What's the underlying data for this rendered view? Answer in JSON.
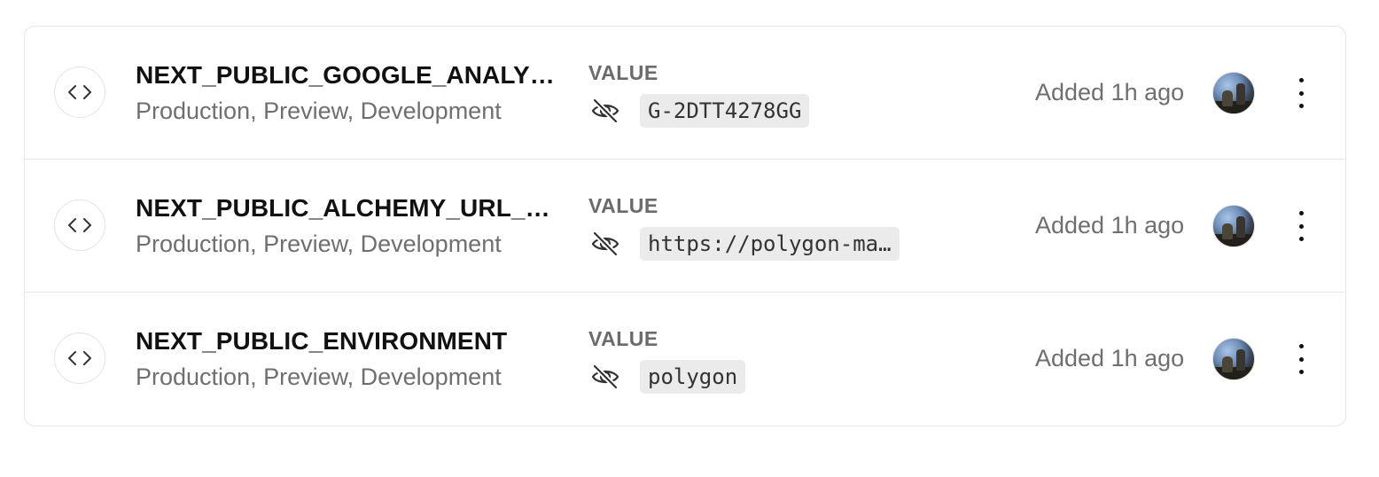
{
  "value_label": "VALUE",
  "rows": [
    {
      "name": "NEXT_PUBLIC_GOOGLE_ANALYTI…",
      "environments": "Production, Preview, Development",
      "value": "G-2DTT4278GG",
      "added": "Added 1h ago"
    },
    {
      "name": "NEXT_PUBLIC_ALCHEMY_URL_P…",
      "environments": "Production, Preview, Development",
      "value": "https://polygon-ma…",
      "added": "Added 1h ago"
    },
    {
      "name": "NEXT_PUBLIC_ENVIRONMENT",
      "environments": "Production, Preview, Development",
      "value": "polygon",
      "added": "Added 1h ago"
    }
  ],
  "icons": {
    "row_icon": "code-brackets-icon",
    "visibility_icon": "eye-off-icon",
    "menu_icon": "more-vertical-icon"
  }
}
